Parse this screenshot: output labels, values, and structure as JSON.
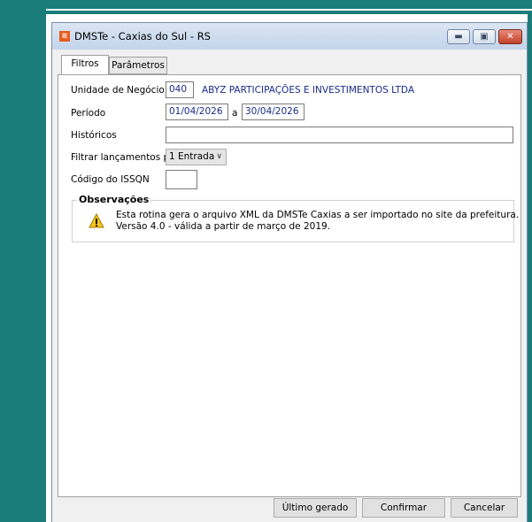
{
  "window": {
    "title": "DMSTe - Caxias do Sul - RS",
    "app_icon": "app-logo-icon",
    "controls": {
      "minimize": "minimize-icon",
      "maximize": "maximize-icon",
      "close": "close-icon"
    }
  },
  "tabs": [
    {
      "label": "Filtros",
      "active": true
    },
    {
      "label": "Parâmetros",
      "active": false
    }
  ],
  "form": {
    "unidade_label": "Unidade de Negócio",
    "unidade_code": "040",
    "unidade_name": "ABYZ PARTICIPAÇÕES E INVESTIMENTOS LTDA",
    "periodo_label": "Período",
    "periodo_start": "01/04/2026",
    "periodo_sep": "a",
    "periodo_end": "30/04/2026",
    "historicos_label": "Históricos",
    "historicos_value": "",
    "filtrar_label": "Filtrar lançamentos por",
    "filtrar_value": "1 Entrada",
    "issqn_label": "Código do ISSQN",
    "issqn_value": ""
  },
  "observacoes": {
    "title": "Observações",
    "icon": "warning-icon",
    "line1": "Esta rotina gera o arquivo XML da DMSTe Caxias a ser importado no site da prefeitura.",
    "line2": "Versão 4.0 - válida a partir de março de 2019."
  },
  "buttons": {
    "ultimo": "Último gerado",
    "confirmar": "Confirmar",
    "cancelar": "Cancelar"
  },
  "colors": {
    "desktop": "#1b7d7a",
    "value_text": "#1a2a8a"
  }
}
